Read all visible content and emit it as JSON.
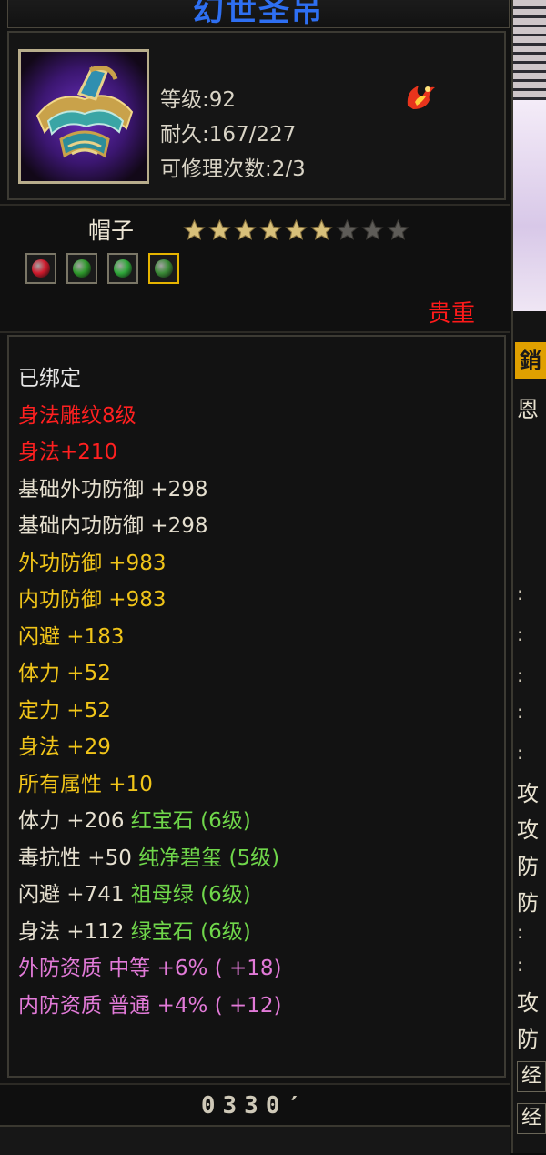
{
  "window": {
    "title": "幻世圣吊"
  },
  "item": {
    "stats": [
      {
        "label": "等级:92"
      },
      {
        "label": "耐久:167/227"
      },
      {
        "label": "可修理次数:2/3"
      }
    ],
    "name": "帽子",
    "star_rating": {
      "filled": 6,
      "total": 9
    },
    "gem_slots": [
      {
        "color": "#d01a2c",
        "selected": false
      },
      {
        "color": "#2f9a2c",
        "selected": false
      },
      {
        "color": "#2fa83a",
        "selected": false
      },
      {
        "color": "#3a8a36",
        "selected": true
      }
    ],
    "rarity": "贵重"
  },
  "attributes": [
    {
      "text": "已绑定",
      "color": "#e6e6e6"
    },
    {
      "text": "身法雕纹8级",
      "color": "#ff2020"
    },
    {
      "text": "身法+210",
      "color": "#ff2020"
    },
    {
      "text": "基础外功防御 +298",
      "color": "#e6e0d0"
    },
    {
      "text": "基础内功防御 +298",
      "color": "#e6e0d0"
    },
    {
      "text": "外功防御 +983",
      "color": "#f0c419"
    },
    {
      "text": "内功防御 +983",
      "color": "#f0c419"
    },
    {
      "text": "闪避 +183",
      "color": "#f0c419"
    },
    {
      "text": "体力 +52",
      "color": "#f0c419"
    },
    {
      "text": "定力 +52",
      "color": "#f0c419"
    },
    {
      "text": "身法 +29",
      "color": "#f0c419"
    },
    {
      "text": "所有属性 +10",
      "color": "#f0c419"
    },
    {
      "text": "体力 +206 红宝石 (6级)",
      "color": "#e6e0d0",
      "gem_color": "#6fd64a"
    },
    {
      "text": "毒抗性 +50 纯净碧玺 (5级)",
      "color": "#e6e0d0",
      "gem_color": "#6fd64a"
    },
    {
      "text": "闪避 +741 祖母绿 (6级)",
      "color": "#e6e0d0",
      "gem_color": "#6fd64a"
    },
    {
      "text": "身法 +112 绿宝石 (6级)",
      "color": "#e6e0d0",
      "gem_color": "#6fd64a"
    },
    {
      "text": "外防资质  中等 +6% ( +18)",
      "color": "#e27ad8"
    },
    {
      "text": "内防资质  普通 +4% ( +12)",
      "color": "#e27ad8"
    }
  ],
  "footer": {
    "value": "0330′"
  },
  "background_window": {
    "tab_char": "銷",
    "label_char": "恩",
    "side_chars": [
      "攻",
      "攻",
      "防",
      "防",
      "攻",
      "防",
      "经",
      "经"
    ],
    "dots": ":"
  }
}
